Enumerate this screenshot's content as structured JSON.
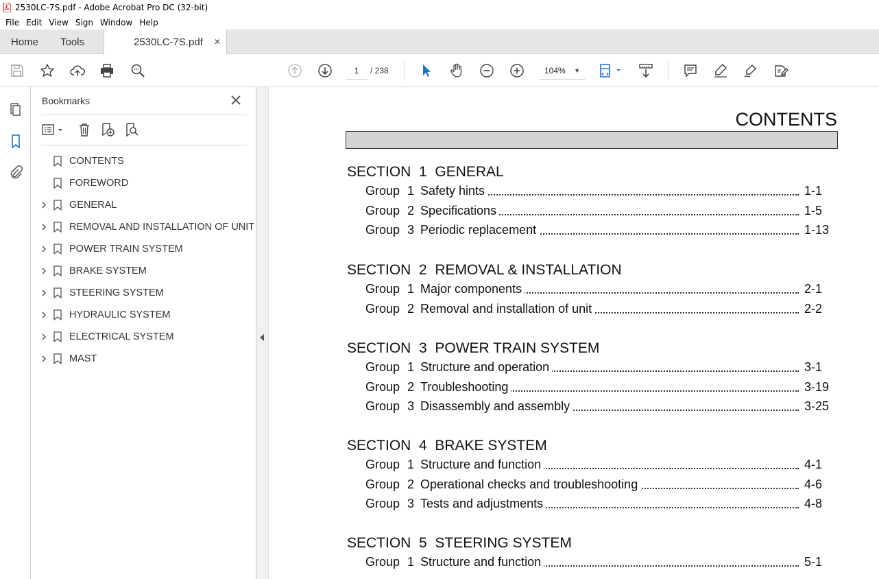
{
  "window": {
    "title": "2530LC-7S.pdf - Adobe Acrobat Pro DC (32-bit)"
  },
  "menu": [
    "File",
    "Edit",
    "View",
    "Sign",
    "Window",
    "Help"
  ],
  "tabs": {
    "home": "Home",
    "tools": "Tools",
    "document": "2530LC-7S.pdf"
  },
  "toolbar": {
    "page_current": "1",
    "page_total": "/ 238",
    "zoom": "104%"
  },
  "bookmarks": {
    "title": "Bookmarks",
    "items": [
      {
        "label": "CONTENTS",
        "expandable": false
      },
      {
        "label": "FOREWORD",
        "expandable": false
      },
      {
        "label": "GENERAL",
        "expandable": true
      },
      {
        "label": "REMOVAL AND INSTALLATION OF UNIT",
        "expandable": true
      },
      {
        "label": "POWER TRAIN SYSTEM",
        "expandable": true
      },
      {
        "label": "BRAKE SYSTEM",
        "expandable": true
      },
      {
        "label": "STEERING SYSTEM",
        "expandable": true
      },
      {
        "label": "HYDRAULIC SYSTEM",
        "expandable": true
      },
      {
        "label": "ELECTRICAL SYSTEM",
        "expandable": true
      },
      {
        "label": "MAST",
        "expandable": true
      }
    ]
  },
  "document": {
    "heading": "CONTENTS",
    "sections": [
      {
        "title": "SECTION  1  GENERAL",
        "groups": [
          {
            "word": "Group",
            "num": "1",
            "title": "Safety hints",
            "page": "1-1"
          },
          {
            "word": "Group",
            "num": "2",
            "title": "Specifications",
            "page": "1-5"
          },
          {
            "word": "Group",
            "num": "3",
            "title": "Periodic replacement",
            "page": "1-13"
          }
        ]
      },
      {
        "title": "SECTION  2  REMOVAL & INSTALLATION",
        "groups": [
          {
            "word": "Group",
            "num": "1",
            "title": "Major components",
            "page": "2-1"
          },
          {
            "word": "Group",
            "num": "2",
            "title": "Removal and installation of unit",
            "page": "2-2"
          }
        ]
      },
      {
        "title": "SECTION  3  POWER TRAIN SYSTEM",
        "groups": [
          {
            "word": "Group",
            "num": "1",
            "title": "Structure and operation",
            "page": "3-1"
          },
          {
            "word": "Group",
            "num": "2",
            "title": "Troubleshooting",
            "page": "3-19"
          },
          {
            "word": "Group",
            "num": "3",
            "title": "Disassembly and assembly",
            "page": "3-25"
          }
        ]
      },
      {
        "title": "SECTION  4  BRAKE SYSTEM",
        "groups": [
          {
            "word": "Group",
            "num": "1",
            "title": "Structure and function",
            "page": "4-1"
          },
          {
            "word": "Group",
            "num": "2",
            "title": "Operational checks and troubleshooting",
            "page": "4-6"
          },
          {
            "word": "Group",
            "num": "3",
            "title": "Tests and adjustments",
            "page": "4-8"
          }
        ]
      },
      {
        "title": "SECTION  5  STEERING SYSTEM",
        "groups": [
          {
            "word": "Group",
            "num": "1",
            "title": "Structure and function",
            "page": "5-1"
          }
        ]
      }
    ]
  }
}
